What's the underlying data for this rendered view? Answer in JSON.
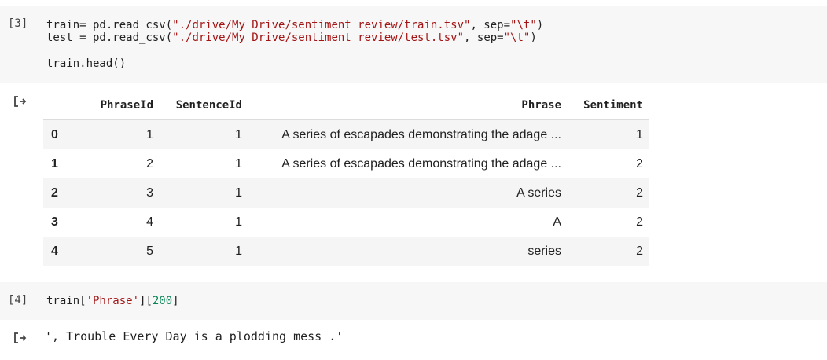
{
  "cells": [
    {
      "prompt": "[3]",
      "lines": [
        [
          "train= pd.read_csv(",
          "\"./drive/My Drive/sentiment review/train.tsv\"",
          ", sep=",
          "\"\\t\"",
          ")"
        ],
        [
          "test = pd.read_csv(",
          "\"./drive/My Drive/sentiment review/test.tsv\"",
          ", sep=",
          "\"\\t\"",
          ")"
        ],
        [
          "train.head()"
        ]
      ]
    },
    {
      "prompt": "[4]",
      "line": {
        "a": "train[",
        "b": "'Phrase'",
        "c": "][",
        "d": "200",
        "e": "]"
      },
      "output": "', Trouble Every Day is a plodding mess .'"
    }
  ],
  "table": {
    "columns": [
      "",
      "PhraseId",
      "SentenceId",
      "Phrase",
      "Sentiment"
    ],
    "rows": [
      [
        "0",
        "1",
        "1",
        "A series of escapades demonstrating the adage ...",
        "1"
      ],
      [
        "1",
        "2",
        "1",
        "A series of escapades demonstrating the adage ...",
        "2"
      ],
      [
        "2",
        "3",
        "1",
        "A series",
        "2"
      ],
      [
        "3",
        "4",
        "1",
        "A",
        "2"
      ],
      [
        "4",
        "5",
        "1",
        "series",
        "2"
      ]
    ]
  },
  "icons": {
    "output": "output-arrow-icon"
  }
}
